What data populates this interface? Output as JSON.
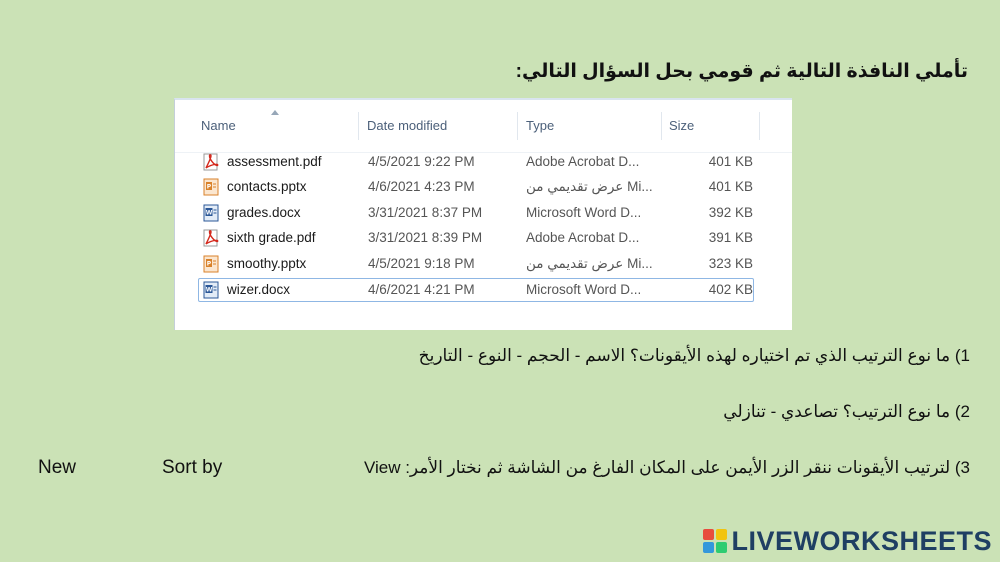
{
  "instruction": "تأملي النافذة التالية ثم قومي بحل السؤال التالي:",
  "explorer": {
    "columns": {
      "name": "Name",
      "date": "Date modified",
      "type": "Type",
      "size": "Size"
    },
    "files": [
      {
        "name": "assessment.pdf",
        "date": "4/5/2021 9:22 PM",
        "type": "Adobe Acrobat D...",
        "size": "401 KB",
        "icon": "pdf-icon"
      },
      {
        "name": "contacts.pptx",
        "date": "4/6/2021 4:23 PM",
        "type": "عرض تقديمي من Mi...",
        "size": "401 KB",
        "icon": "pptx-icon"
      },
      {
        "name": "grades.docx",
        "date": "3/31/2021 8:37 PM",
        "type": "Microsoft Word D...",
        "size": "392 KB",
        "icon": "docx-icon"
      },
      {
        "name": "sixth grade.pdf",
        "date": "3/31/2021 8:39 PM",
        "type": "Adobe Acrobat D...",
        "size": "391 KB",
        "icon": "pdf-icon"
      },
      {
        "name": "smoothy.pptx",
        "date": "4/5/2021 9:18 PM",
        "type": "عرض تقديمي من Mi...",
        "size": "323 KB",
        "icon": "pptx-icon"
      },
      {
        "name": "wizer.docx",
        "date": "4/6/2021 4:21 PM",
        "type": "Microsoft Word D...",
        "size": "402 KB",
        "icon": "docx-icon",
        "selected": true
      }
    ]
  },
  "questions": {
    "q1": "1) ما نوع الترتيب الذي تم اختياره لهذه الأيقونات؟  الاسم  - الحجم  - النوع  -  التاريخ",
    "q2": "2) ما نوع الترتيب؟  تصاعدي  -  تنازلي",
    "q3": "3) لترتيب الأيقونات ننقر الزر الأيمن على المكان الفارغ من الشاشة ثم نختار الأمر: View"
  },
  "options": {
    "sort_by": "Sort by",
    "new": "New"
  },
  "logo": {
    "text": "LIVEWORKSHEETS"
  },
  "colors": {
    "background": "#cbe2b6",
    "pdf": "#d4281c",
    "pptx": "#d9822b",
    "docx": "#2b5797",
    "selection": "#8fb7e4"
  }
}
